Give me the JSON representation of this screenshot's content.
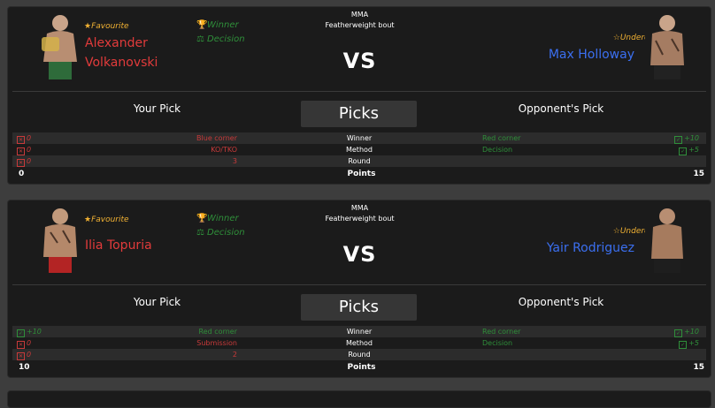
{
  "bouts": [
    {
      "favourite_tag": "Favourite",
      "underdog_tag": "Underdog",
      "red_name": "Alexander Volkanovski",
      "blue_name": "Max Holloway",
      "result_winner": "Winner",
      "result_method": "Decision",
      "sport": "MMA",
      "weight_class": "Featherweight bout",
      "vs": "VS",
      "your_pick_label": "Your Pick",
      "picks_button": "Picks",
      "opponent_pick_label": "Opponent's Pick",
      "rows": [
        {
          "left_score": "0",
          "left_pick": "Blue corner",
          "label": "Winner",
          "right_pick": "Red corner",
          "right_score": "+10"
        },
        {
          "left_score": "0",
          "left_pick": "KO/TKO",
          "label": "Method",
          "right_pick": "Decision",
          "right_score": "+5"
        },
        {
          "left_score": "0",
          "left_pick": "3",
          "label": "Round",
          "right_pick": "",
          "right_score": ""
        }
      ],
      "points_left": "0",
      "points_label": "Points",
      "points_right": "15"
    },
    {
      "favourite_tag": "Favourite",
      "underdog_tag": "Underdog",
      "red_name": "Ilia Topuria",
      "blue_name": "Yair Rodriguez",
      "result_winner": "Winner",
      "result_method": "Decision",
      "sport": "MMA",
      "weight_class": "Featherweight bout",
      "vs": "VS",
      "your_pick_label": "Your Pick",
      "picks_button": "Picks",
      "opponent_pick_label": "Opponent's Pick",
      "rows": [
        {
          "left_score": "+10",
          "left_pick": "Red corner",
          "label": "Winner",
          "right_pick": "Red corner",
          "right_score": "+10"
        },
        {
          "left_score": "0",
          "left_pick": "Submission",
          "label": "Method",
          "right_pick": "Decision",
          "right_score": "+5"
        },
        {
          "left_score": "0",
          "left_pick": "2",
          "label": "Round",
          "right_pick": "",
          "right_score": ""
        }
      ],
      "points_left": "10",
      "points_label": "Points",
      "points_right": "15"
    }
  ],
  "colors": {
    "red_corner": "#e23b3b",
    "blue_corner": "#3b6ff0",
    "correct": "#2f8f3a",
    "wrong": "#c93a3a",
    "tag": "#f2b233"
  }
}
